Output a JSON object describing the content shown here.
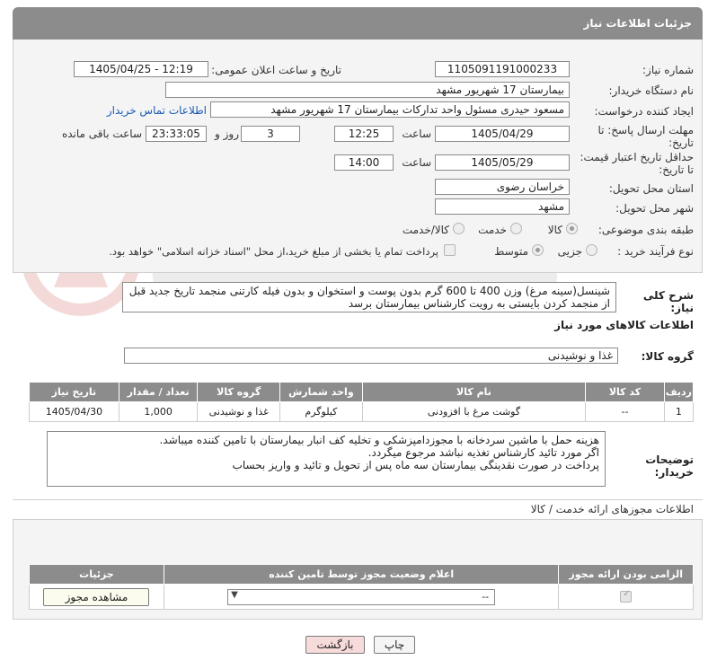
{
  "header": {
    "title": "جزئیات اطلاعات نیاز"
  },
  "fields": {
    "need_number": {
      "label": "شماره نیاز:",
      "value": "1105091191000233"
    },
    "announce_datetime": {
      "label": "تاریخ و ساعت اعلان عمومی:",
      "value": "1405/04/25 - 12:19"
    },
    "buyer_org": {
      "label": "نام دستگاه خریدار:",
      "value": "بیمارستان 17 شهریور مشهد"
    },
    "requester": {
      "label": "ایجاد کننده درخواست:",
      "value": "مسعود حیدری مسئول واحد تدارکات  بیمارستان 17 شهریور مشهد",
      "contact_link": "اطلاعات تماس خریدار"
    },
    "reply_deadline": {
      "label": "مهلت ارسال پاسخ: تا تاریخ:",
      "date": "1405/04/29",
      "time_label": "ساعت",
      "time": "12:25",
      "days": "3",
      "days_label": "روز و",
      "remaining": "23:33:05",
      "remaining_label": "ساعت باقی مانده"
    },
    "price_validity": {
      "label": "حداقل تاریخ اعتبار قیمت: تا تاریخ:",
      "date": "1405/05/29",
      "time_label": "ساعت",
      "time": "14:00"
    },
    "province": {
      "label": "استان محل تحویل:",
      "value": "خراسان رضوی"
    },
    "city": {
      "label": "شهر محل تحویل:",
      "value": "مشهد"
    },
    "category": {
      "label": "طبقه بندی موضوعی:",
      "options": [
        "کالا",
        "خدمت",
        "کالا/خدمت"
      ],
      "selected": "کالا"
    },
    "process": {
      "label": "نوع فرآیند خرید :",
      "options": [
        "جزیی",
        "متوسط"
      ],
      "selected": "متوسط",
      "note": "پرداخت تمام یا بخشی از مبلغ خرید،از محل \"اسناد خزانه اسلامی\" خواهد بود."
    }
  },
  "description": {
    "label": "شرح کلی نیاز:",
    "text": "شینسل(سینه مرغ) وزن 400 تا 600 گرم بدون پوست و استخوان و بدون فیله کارتنی منجمد تاریخ جدید قبل از منجمد کردن بایستی به رویت کارشناس بیمارستان برسد"
  },
  "goods_section": {
    "title": "اطلاعات کالاهای مورد نیاز",
    "group_label": "گروه کالا:",
    "group_value": "غذا و نوشیدنی",
    "columns": [
      "ردیف",
      "کد کالا",
      "نام کالا",
      "واحد شمارش",
      "گروه کالا",
      "تعداد / مقدار",
      "تاریخ نیاز"
    ],
    "rows": [
      {
        "row": "1",
        "code": "--",
        "name": "گوشت مرغ با افزودنی",
        "unit": "کیلوگرم",
        "group": "غذا و نوشیدنی",
        "qty": "1,000",
        "date": "1405/04/30"
      }
    ]
  },
  "buyer_notes": {
    "label": "توضیحات خریدار:",
    "lines": [
      "هزینه حمل با ماشین سردخانه با مجوزدامپزشکی و تخلیه کف انبار بیمارستان با تامین کننده میباشد.",
      "اگر مورد تائید کارشناس تغذیه نباشد مرجوع میگردد.",
      "پرداخت در صورت نقدینگی بیمارستان سه ماه پس از تحویل و تائید و واریز بحساب"
    ]
  },
  "permits": {
    "title": "اطلاعات مجوزهای ارائه خدمت / کالا",
    "columns": [
      "الزامی بودن ارائه مجوز",
      "اعلام وضعیت مجوز توسط تامین کننده",
      "جزئیات"
    ],
    "select_value": "--",
    "view_button": "مشاهده مجوز"
  },
  "actions": {
    "print": "چاپ",
    "back": "بازگشت"
  },
  "colors": {
    "header_bg": "#8c8c8c",
    "link": "#1a5bb5",
    "back_button": "#f7dada"
  }
}
